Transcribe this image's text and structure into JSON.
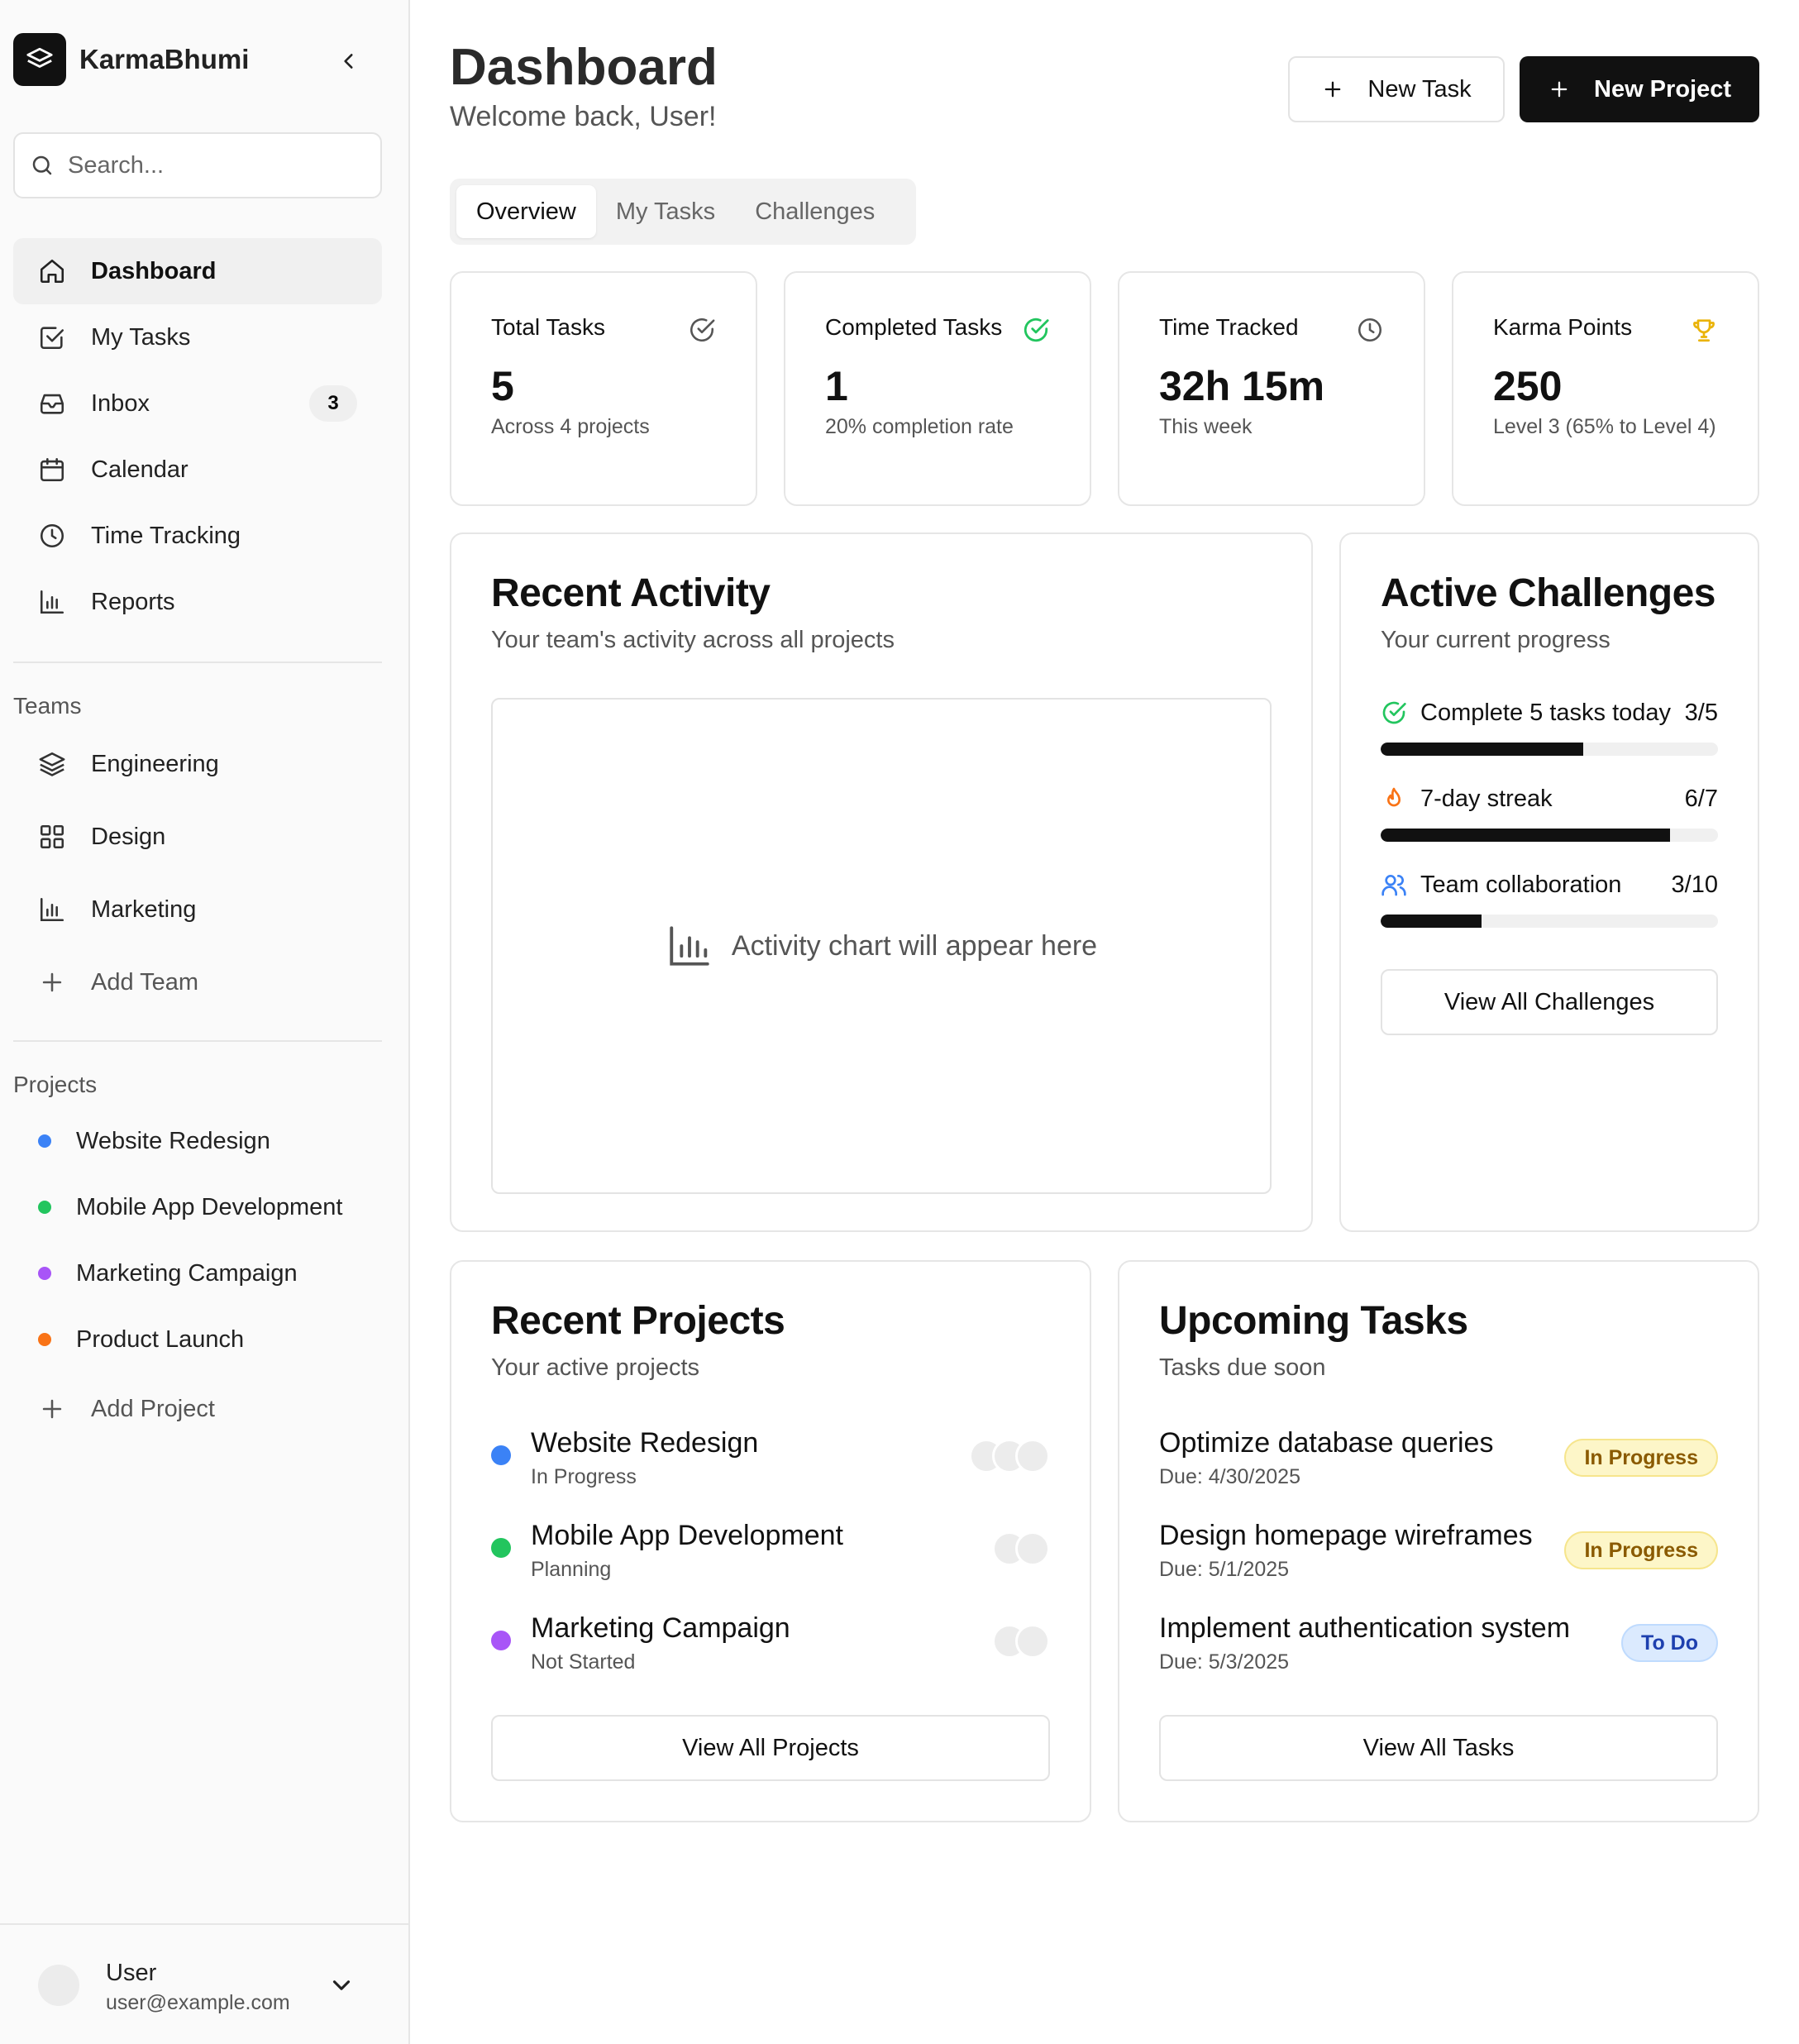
{
  "app": {
    "name": "KarmaBhumi"
  },
  "sidebar": {
    "search_placeholder": "Search...",
    "nav": [
      {
        "label": "Dashboard",
        "icon": "home-icon",
        "active": true
      },
      {
        "label": "My Tasks",
        "icon": "check-square-icon"
      },
      {
        "label": "Inbox",
        "icon": "inbox-icon",
        "badge": "3"
      },
      {
        "label": "Calendar",
        "icon": "calendar-icon"
      },
      {
        "label": "Time Tracking",
        "icon": "clock-icon"
      },
      {
        "label": "Reports",
        "icon": "bar-chart-icon"
      }
    ],
    "teams_title": "Teams",
    "teams": [
      {
        "label": "Engineering",
        "icon": "layers-icon"
      },
      {
        "label": "Design",
        "icon": "grid-icon"
      },
      {
        "label": "Marketing",
        "icon": "bar-chart-icon"
      }
    ],
    "add_team": "Add Team",
    "projects_title": "Projects",
    "projects": [
      {
        "label": "Website Redesign",
        "color": "#3b82f6"
      },
      {
        "label": "Mobile App Development",
        "color": "#22c55e"
      },
      {
        "label": "Marketing Campaign",
        "color": "#a855f7"
      },
      {
        "label": "Product Launch",
        "color": "#f97316"
      }
    ],
    "add_project": "Add Project",
    "user": {
      "name": "User",
      "email": "user@example.com"
    }
  },
  "header": {
    "title": "Dashboard",
    "subtitle": "Welcome back, User!",
    "new_task": "New Task",
    "new_project": "New Project"
  },
  "tabs": [
    {
      "label": "Overview",
      "active": true
    },
    {
      "label": "My Tasks"
    },
    {
      "label": "Challenges"
    }
  ],
  "stats": [
    {
      "title": "Total Tasks",
      "value": "5",
      "sub": "Across 4 projects",
      "icon": "check-circle-icon",
      "icon_color": "#555555"
    },
    {
      "title": "Completed Tasks",
      "value": "1",
      "sub": "20% completion rate",
      "icon": "check-circle-icon",
      "icon_color": "#22c55e"
    },
    {
      "title": "Time Tracked",
      "value": "32h 15m",
      "sub": "This week",
      "icon": "clock-icon",
      "icon_color": "#555555"
    },
    {
      "title": "Karma Points",
      "value": "250",
      "sub": "Level 3 (65% to Level 4)",
      "icon": "trophy-icon",
      "icon_color": "#eab308"
    }
  ],
  "recent_activity": {
    "title": "Recent Activity",
    "subtitle": "Your team's activity across all projects",
    "placeholder": "Activity chart will appear here"
  },
  "active_challenges": {
    "title": "Active Challenges",
    "subtitle": "Your current progress",
    "items": [
      {
        "label": "Complete 5 tasks today",
        "value": "3/5",
        "progress": 0.6,
        "icon": "check-circle-icon",
        "color": "#22c55e"
      },
      {
        "label": "7-day streak",
        "value": "6/7",
        "progress": 0.857,
        "icon": "flame-icon",
        "color": "#f97316"
      },
      {
        "label": "Team collaboration",
        "value": "3/10",
        "progress": 0.3,
        "icon": "users-icon",
        "color": "#3b82f6"
      }
    ],
    "button": "View All Challenges"
  },
  "recent_projects": {
    "title": "Recent Projects",
    "subtitle": "Your active projects",
    "items": [
      {
        "name": "Website Redesign",
        "status": "In Progress",
        "color": "#3b82f6",
        "avatars": 3
      },
      {
        "name": "Mobile App Development",
        "status": "Planning",
        "color": "#22c55e",
        "avatars": 2
      },
      {
        "name": "Marketing Campaign",
        "status": "Not Started",
        "color": "#a855f7",
        "avatars": 2
      }
    ],
    "button": "View All Projects"
  },
  "upcoming_tasks": {
    "title": "Upcoming Tasks",
    "subtitle": "Tasks due soon",
    "items": [
      {
        "name": "Optimize database queries",
        "due": "Due: 4/30/2025",
        "status": "In Progress",
        "kind": "progress"
      },
      {
        "name": "Design homepage wireframes",
        "due": "Due: 5/1/2025",
        "status": "In Progress",
        "kind": "progress"
      },
      {
        "name": "Implement authentication system",
        "due": "Due: 5/3/2025",
        "status": "To Do",
        "kind": "todo"
      }
    ],
    "button": "View All Tasks"
  }
}
